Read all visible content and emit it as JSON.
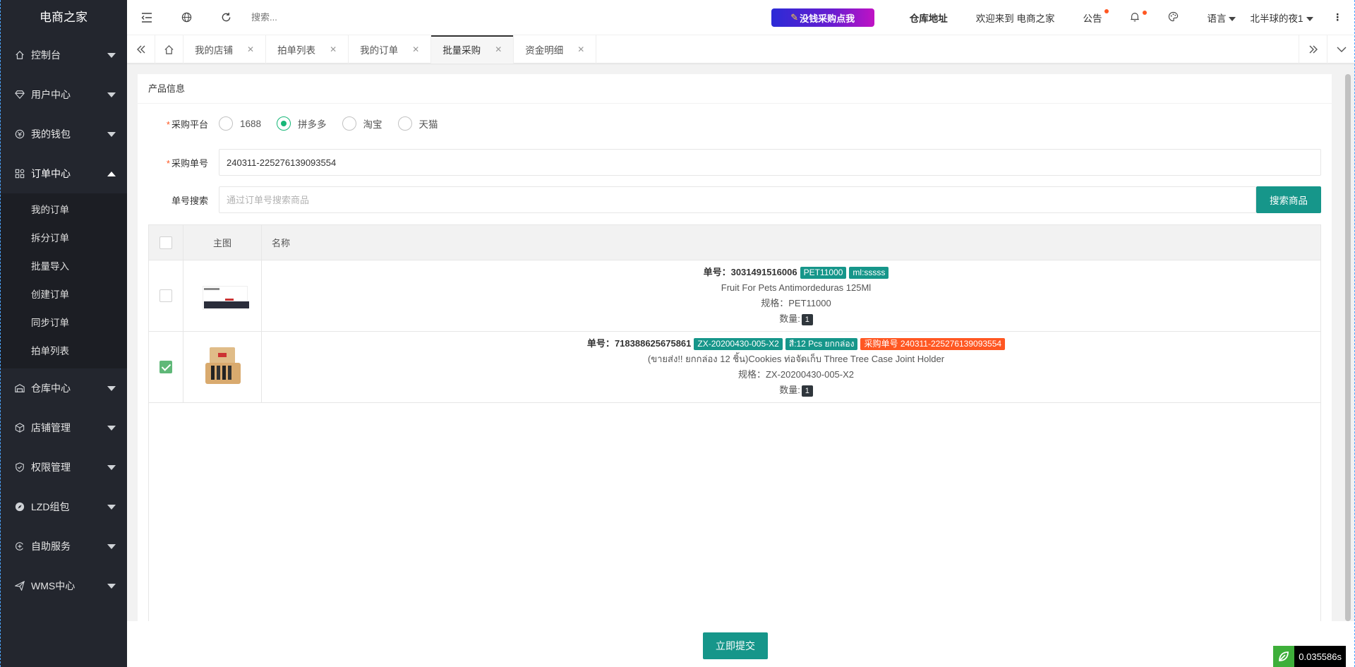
{
  "app": {
    "logo": "电商之家"
  },
  "sidebar": {
    "items": [
      {
        "label": "控制台",
        "icon": "home-icon"
      },
      {
        "label": "用户中心",
        "icon": "diamond-icon"
      },
      {
        "label": "我的钱包",
        "icon": "wallet-icon"
      },
      {
        "label": "订单中心",
        "icon": "apps-icon",
        "open": true,
        "children": [
          "我的订单",
          "拆分订单",
          "批量导入",
          "创建订单",
          "同步订单",
          "拍单列表"
        ]
      },
      {
        "label": "仓库中心",
        "icon": "warehouse-icon"
      },
      {
        "label": "店铺管理",
        "icon": "cube-icon"
      },
      {
        "label": "权限管理",
        "icon": "shield-icon"
      },
      {
        "label": "LZD组包",
        "icon": "compass-icon"
      },
      {
        "label": "自助服务",
        "icon": "service-icon"
      },
      {
        "label": "WMS中心",
        "icon": "send-icon"
      }
    ]
  },
  "header": {
    "search_placeholder": "搜索...",
    "promo": "没钱采购点我",
    "warehouse_link": "仓库地址",
    "welcome": "欢迎来到 电商之家",
    "notice": "公告",
    "language": "语言",
    "user": "北半球的夜1"
  },
  "tabs": [
    {
      "label": "我的店铺"
    },
    {
      "label": "拍单列表"
    },
    {
      "label": "我的订单"
    },
    {
      "label": "批量采购",
      "active": true
    },
    {
      "label": "资金明细"
    }
  ],
  "form": {
    "card_title": "产品信息",
    "platform_label": "采购平台",
    "platforms": [
      "1688",
      "拼多多",
      "淘宝",
      "天猫"
    ],
    "platform_selected": "拼多多",
    "order_no_label": "采购单号",
    "order_no_value": "240311-225276139093554",
    "search_label": "单号搜索",
    "search_placeholder": "通过订单号搜索商品",
    "search_button": "搜索商品"
  },
  "table": {
    "headers": [
      "主图",
      "名称"
    ],
    "rows": [
      {
        "checked": false,
        "order_prefix": "单号：",
        "order_no": "3031491516006",
        "tags": [
          {
            "text": "PET11000",
            "color": "teal"
          },
          {
            "text": "ml:sssss",
            "color": "teal"
          }
        ],
        "name": "Fruit For Pets Antimordeduras 125Ml",
        "spec_label": "规格：",
        "spec": "PET11000",
        "qty_label": "数量:",
        "qty": "1"
      },
      {
        "checked": true,
        "order_prefix": "单号：",
        "order_no": "718388625675861",
        "tags": [
          {
            "text": "ZX-20200430-005-X2",
            "color": "teal"
          },
          {
            "text": "สี:12 Pcs ยกกล่อง",
            "color": "teal"
          },
          {
            "text": "采购单号 240311-225276139093554",
            "color": "orange"
          }
        ],
        "name": "(ขายส่ง!! ยกกล่อง 12 ชิ้น)Cookies ท่อจัดเก็บ Three Tree Case Joint Holder",
        "spec_label": "规格：",
        "spec": "ZX-20200430-005-X2",
        "qty_label": "数量:",
        "qty": "1"
      }
    ]
  },
  "footer": {
    "submit": "立即提交",
    "timer": "0.035586s"
  },
  "colors": {
    "sidebar": "#23262e",
    "accent": "#16968a",
    "radio": "#16b777",
    "orange": "#ff5722"
  }
}
